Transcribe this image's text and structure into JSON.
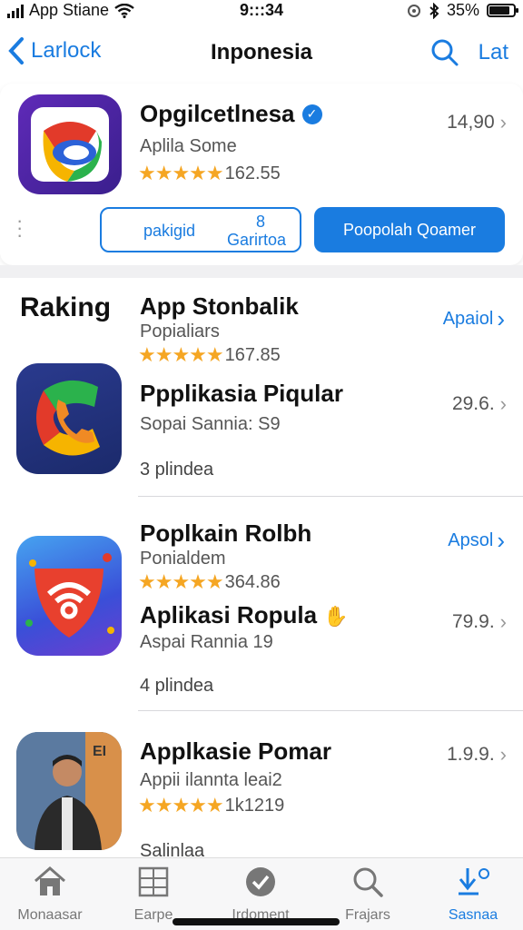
{
  "status_bar": {
    "carrier": "App Stiane",
    "time": "9:::34",
    "battery": "35%"
  },
  "nav": {
    "back_label": "Larlock",
    "title": "Inponesia",
    "right_label": "Lat"
  },
  "featured": {
    "name": "Opgilcetlnesa",
    "subtitle": "Aplila Some",
    "rating_text": "162.55",
    "price": "14,90",
    "btn_outline_1": "pakigid",
    "btn_outline_2a": "8",
    "btn_outline_2b": "Garirtoa",
    "btn_fill": "Poopolah Qoamer"
  },
  "section": {
    "title": "Raking"
  },
  "items": [
    {
      "heading": "App Stonbalik",
      "heading_sub": "Popialiars",
      "heading_rating": "167.85",
      "heading_link": "Apaiol",
      "name": "Ppplikasia Piqular",
      "sub": "Sopai Sannia: S9",
      "price": "29.6.",
      "meta": "3 plindea"
    },
    {
      "heading": "Poplkain Rolbh",
      "heading_sub": "Ponialdem",
      "heading_rating": "364.86",
      "heading_link": "Apsol",
      "name": "Aplikasi  Ropula",
      "sub": "Aspai Rannia 19",
      "price": "79.9.",
      "meta": "4 plindea"
    },
    {
      "heading": "",
      "heading_sub": "",
      "heading_rating": "",
      "heading_link": "",
      "name": "Applkasie Pomar",
      "sub": "Appii ilannta leai2",
      "price": "1.9.9.",
      "meta": "1k1219"
    }
  ],
  "cutoff_text": "Salinlaa",
  "tabs": [
    {
      "label": "Monaasar",
      "icon": "home-icon"
    },
    {
      "label": "Earpe",
      "icon": "grid-icon"
    },
    {
      "label": "Irdoment",
      "icon": "check-icon"
    },
    {
      "label": "Frajars",
      "icon": "search-icon"
    },
    {
      "label": "Sasnaa",
      "icon": "download-icon"
    }
  ],
  "colors": {
    "accent": "#1a7ce0",
    "star": "#f5a623"
  }
}
